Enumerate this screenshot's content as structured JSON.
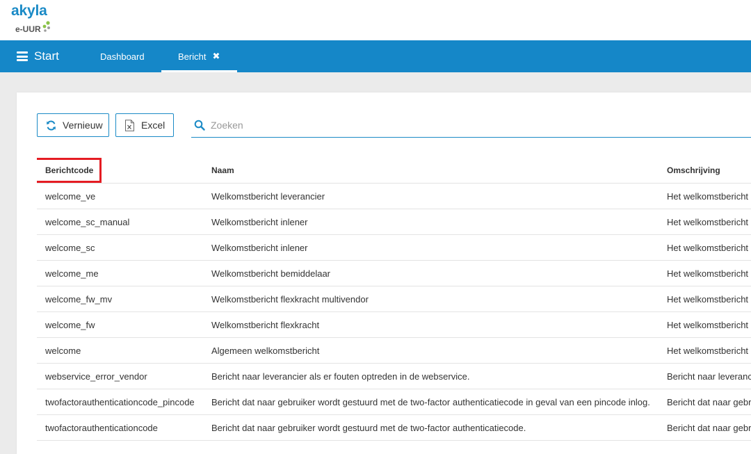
{
  "logo": {
    "brand": "akyla",
    "sub": "e-UUR",
    "colors": {
      "brand": "#1a8ac6",
      "dot_green": "#8bc34a",
      "dot_gray": "#9e9e9e"
    }
  },
  "nav": {
    "start_label": "Start",
    "tabs": [
      {
        "label": "Dashboard"
      },
      {
        "label": "Bericht"
      }
    ],
    "colors": {
      "bar": "#1587c8"
    }
  },
  "toolbar": {
    "refresh_label": "Vernieuw",
    "excel_label": "Excel",
    "search_placeholder": "Zoeken",
    "search_value": ""
  },
  "table": {
    "columns": [
      "Berichtcode",
      "Naam",
      "Omschrijving"
    ],
    "rows": [
      [
        "welcome_ve",
        "Welkomstbericht leverancier",
        "Het welkomstbericht"
      ],
      [
        "welcome_sc_manual",
        "Welkomstbericht inlener",
        "Het welkomstbericht"
      ],
      [
        "welcome_sc",
        "Welkomstbericht inlener",
        "Het welkomstbericht"
      ],
      [
        "welcome_me",
        "Welkomstbericht bemiddelaar",
        "Het welkomstbericht"
      ],
      [
        "welcome_fw_mv",
        "Welkomstbericht flexkracht multivendor",
        "Het welkomstbericht"
      ],
      [
        "welcome_fw",
        "Welkomstbericht flexkracht",
        "Het welkomstbericht"
      ],
      [
        "welcome",
        "Algemeen welkomstbericht",
        "Het welkomstbericht"
      ],
      [
        "webservice_error_vendor",
        "Bericht naar leverancier als er fouten optreden in de webservice.",
        "Bericht naar leveranc"
      ],
      [
        "twofactorauthenticationcode_pincode",
        "Bericht dat naar gebruiker wordt gestuurd met de two-factor authenticatiecode in geval van een pincode inlog.",
        "Bericht dat naar gebr"
      ],
      [
        "twofactorauthenticationcode",
        "Bericht dat naar gebruiker wordt gestuurd met de two-factor authenticatiecode.",
        "Bericht dat naar gebr"
      ]
    ],
    "highlight_color": "#e51c23"
  }
}
